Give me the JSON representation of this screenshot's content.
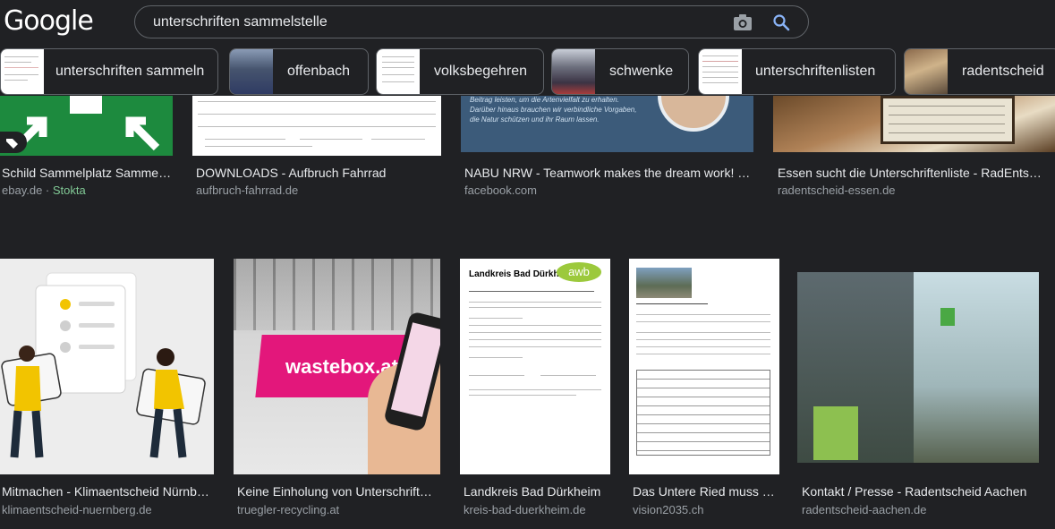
{
  "header": {
    "logo": "Google",
    "query": "unterschriften sammelstelle"
  },
  "chips": [
    {
      "label": "unterschriften sammeln"
    },
    {
      "label": "offenbach"
    },
    {
      "label": "volksbegehren"
    },
    {
      "label": "schwenke"
    },
    {
      "label": "unterschriftenlisten"
    },
    {
      "label": "radentscheid"
    }
  ],
  "row1": [
    {
      "title": "Schild Sammelplatz Sammels...",
      "source": "ebay.de",
      "extra": "Stokta",
      "dot": " · "
    },
    {
      "title": "DOWNLOADS - Aufbruch Fahrrad",
      "source": "aufbruch-fahrrad.de"
    },
    {
      "title": "NABU NRW - Teamwork makes the dream work! 💪...",
      "source": "facebook.com"
    },
    {
      "title": "Essen sucht die Unterschriftenliste - RadEntscheid ...",
      "source": "radentscheid-essen.de"
    }
  ],
  "row2": [
    {
      "title": "Mitmachen - Klimaentscheid Nürnberg",
      "source": "klimaentscheid-nuernberg.de"
    },
    {
      "title": "Keine Einholung von Unterschriften...",
      "source": "truegler-recycling.at",
      "brand": "wastebox.at"
    },
    {
      "title": "Landkreis Bad Dürkheim",
      "source": "kreis-bad-duerkheim.de",
      "doc_heading": "Landkreis Bad Dürkheim",
      "doc_logo": "awb"
    },
    {
      "title": "Das Untere Ried muss er...",
      "source": "vision2035.ch"
    },
    {
      "title": "Kontakt / Presse - Radentscheid Aachen",
      "source": "radentscheid-aachen.de"
    }
  ],
  "snippet": {
    "line1": "Beitrag leisten, um die Artenvielfalt zu erhalten.",
    "line2": "Darüber hinaus brauchen wir verbindliche Vorgaben,",
    "line3": "die Natur schützen und ihr Raum lassen."
  }
}
